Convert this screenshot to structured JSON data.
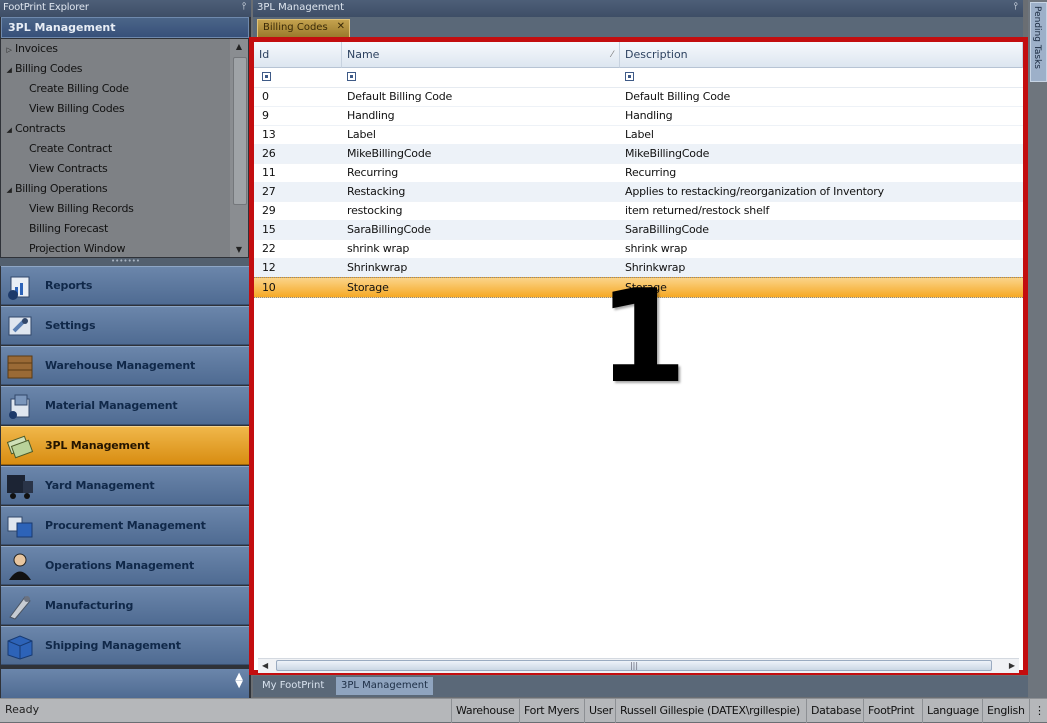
{
  "explorer": {
    "title": "FootPrint Explorer",
    "section_header": "3PL Management",
    "tree_items": [
      {
        "label": "Invoices",
        "level": 0,
        "expander": "collapsed"
      },
      {
        "label": "Billing Codes",
        "level": 0,
        "expander": "expanded"
      },
      {
        "label": "Create Billing Code",
        "level": 1
      },
      {
        "label": "View Billing Codes",
        "level": 1
      },
      {
        "label": "Contracts",
        "level": 0,
        "expander": "expanded"
      },
      {
        "label": "Create Contract",
        "level": 1
      },
      {
        "label": "View Contracts",
        "level": 1
      },
      {
        "label": "Billing Operations",
        "level": 0,
        "expander": "expanded"
      },
      {
        "label": "View Billing Records",
        "level": 1
      },
      {
        "label": "Billing Forecast",
        "level": 1
      },
      {
        "label": "Projection Window",
        "level": 1
      }
    ],
    "nav_buttons": [
      {
        "label": "Reports",
        "icon": "reports-icon",
        "active": false
      },
      {
        "label": "Settings",
        "icon": "settings-icon",
        "active": false
      },
      {
        "label": "Warehouse Management",
        "icon": "warehouse-icon",
        "active": false
      },
      {
        "label": "Material Management",
        "icon": "material-icon",
        "active": false
      },
      {
        "label": "3PL Management",
        "icon": "3pl-icon",
        "active": true
      },
      {
        "label": "Yard Management",
        "icon": "yard-icon",
        "active": false
      },
      {
        "label": "Procurement Management",
        "icon": "procurement-icon",
        "active": false
      },
      {
        "label": "Operations Management",
        "icon": "operations-icon",
        "active": false
      },
      {
        "label": "Manufacturing",
        "icon": "manufacturing-icon",
        "active": false
      },
      {
        "label": "Shipping Management",
        "icon": "shipping-icon",
        "active": false
      }
    ]
  },
  "main": {
    "title": "3PL Management",
    "doc_tab": "Billing Codes",
    "grid": {
      "columns": [
        "Id",
        "Name",
        "Description"
      ],
      "rows": [
        {
          "id": "0",
          "name": "Default Billing Code",
          "description": "Default Billing Code"
        },
        {
          "id": "9",
          "name": "Handling",
          "description": "Handling"
        },
        {
          "id": "13",
          "name": "Label",
          "description": "Label"
        },
        {
          "id": "26",
          "name": "MikeBillingCode",
          "description": "MikeBillingCode"
        },
        {
          "id": "11",
          "name": "Recurring",
          "description": "Recurring"
        },
        {
          "id": "27",
          "name": "Restacking",
          "description": "Applies to restacking/reorganization of Inventory"
        },
        {
          "id": "29",
          "name": "restocking",
          "description": "item returned/restock shelf"
        },
        {
          "id": "15",
          "name": "SaraBillingCode",
          "description": "SaraBillingCode"
        },
        {
          "id": "22",
          "name": "shrink wrap",
          "description": "shrink wrap"
        },
        {
          "id": "12",
          "name": "Shrinkwrap",
          "description": "Shrinkwrap"
        },
        {
          "id": "10",
          "name": "Storage",
          "description": "Storage"
        }
      ],
      "selected_row_index": 10
    },
    "annotation": "1",
    "bottom_tabs": [
      "My FootPrint",
      "3PL Management"
    ],
    "active_bottom_tab": 1
  },
  "pending_tasks": "Pending Tasks",
  "status": {
    "ready": "Ready",
    "items": [
      "Warehouse",
      "Fort Myers",
      "User",
      "Russell Gillespie (DATEX\\rgillespie)",
      "Database",
      "FootPrint",
      "Language",
      "English"
    ]
  },
  "colors": {
    "highlight_frame": "#c30d0f",
    "selected_row": "#f6a925",
    "active_nav": "#e6a42a"
  }
}
